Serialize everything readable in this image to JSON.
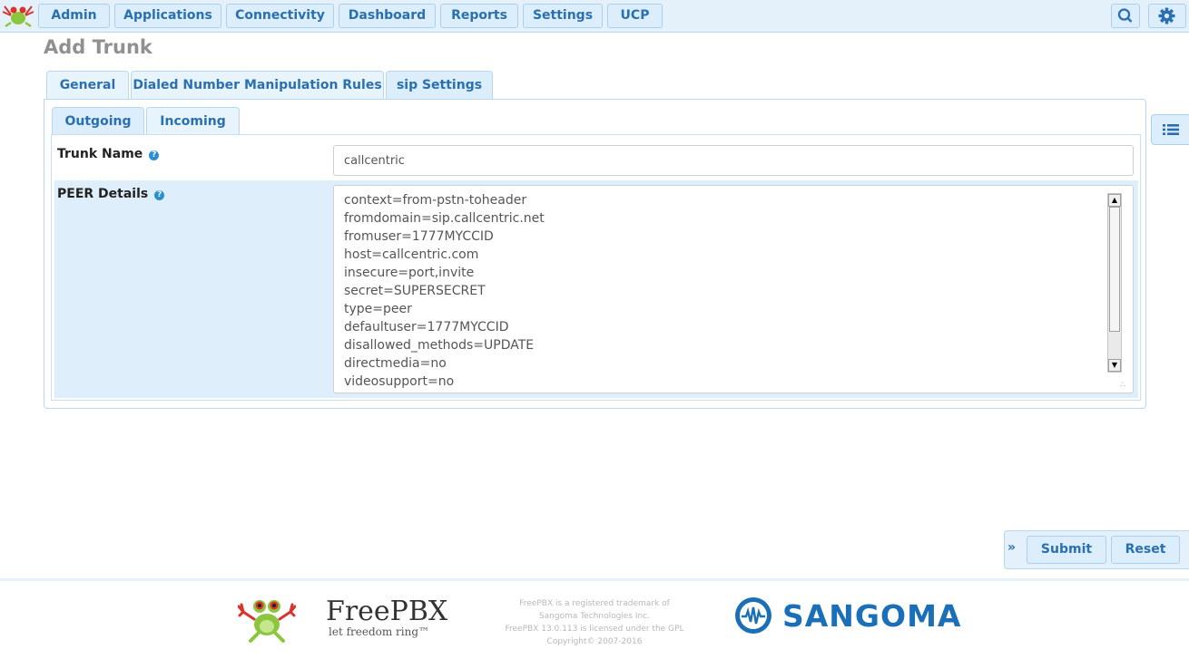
{
  "nav": {
    "items": [
      {
        "label": "Admin"
      },
      {
        "label": "Applications"
      },
      {
        "label": "Connectivity"
      },
      {
        "label": "Dashboard"
      },
      {
        "label": "Reports"
      },
      {
        "label": "Settings"
      },
      {
        "label": "UCP"
      }
    ],
    "search_icon": "search-icon",
    "settings_icon": "gear-icon"
  },
  "page": {
    "title": "Add Trunk"
  },
  "tabs": [
    {
      "label": "General",
      "active": false
    },
    {
      "label": "Dialed Number Manipulation Rules",
      "active": false
    },
    {
      "label": "sip Settings",
      "active": true
    }
  ],
  "subtabs": [
    {
      "label": "Outgoing",
      "active": true
    },
    {
      "label": "Incoming",
      "active": false
    }
  ],
  "form": {
    "trunk_name": {
      "label": "Trunk Name",
      "value": "callcentric"
    },
    "peer_details": {
      "label": "PEER Details",
      "lines": [
        "context=from-pstn-toheader",
        "fromdomain=sip.callcentric.net",
        "fromuser=1777MYCCID",
        "host=callcentric.com",
        "insecure=port,invite",
        "secret=SUPERSECRET",
        "type=peer",
        "defaultuser=1777MYCCID",
        "disallowed_methods=UPDATE",
        "directmedia=no",
        "videosupport=no"
      ]
    }
  },
  "actions": {
    "toggle": "»",
    "submit": "Submit",
    "reset": "Reset"
  },
  "footer": {
    "brand": "FreePBX",
    "tagline": "let freedom ring™",
    "legal": [
      "FreePBX is a registered trademark of",
      "Sangoma Technologies Inc.",
      "FreePBX 13.0.113 is licensed under the GPL",
      "Copyright© 2007-2016"
    ],
    "partner": "SANGOMA"
  },
  "colors": {
    "accent": "#2a6fb0",
    "nav_bg": "#e4f1fb",
    "row_highlight": "#deeefa",
    "sangoma_blue": "#1a6fb8"
  }
}
